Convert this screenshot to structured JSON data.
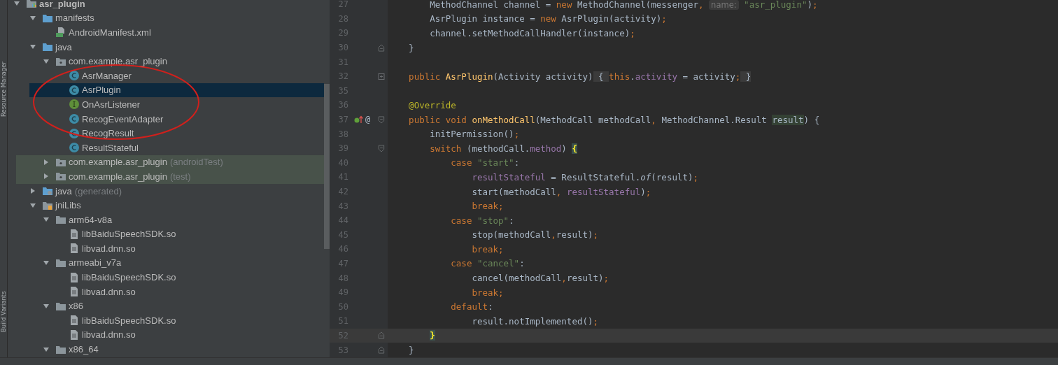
{
  "side_tabs": [
    {
      "label": "Resource Manager"
    },
    {
      "label": "Build Variants"
    }
  ],
  "project_tree": [
    {
      "label": "asr_plugin",
      "kind": "module",
      "expanded": true,
      "selected": false,
      "children": [
        {
          "label": "manifests",
          "kind": "folder",
          "expanded": true,
          "selected": false,
          "children": [
            {
              "label": "AndroidManifest.xml",
              "kind": "manifest",
              "selected": false
            }
          ]
        },
        {
          "label": "java",
          "kind": "folder",
          "expanded": true,
          "selected": false,
          "children": [
            {
              "label": "com.example.asr_plugin",
              "kind": "package",
              "expanded": true,
              "selected": false,
              "children": [
                {
                  "label": "AsrManager",
                  "kind": "class",
                  "selected": false
                },
                {
                  "label": "AsrPlugin",
                  "kind": "class",
                  "selected": true
                },
                {
                  "label": "OnAsrListener",
                  "kind": "interface",
                  "selected": false
                },
                {
                  "label": "RecogEventAdapter",
                  "kind": "class",
                  "selected": false
                },
                {
                  "label": "RecogResult",
                  "kind": "class",
                  "selected": false
                },
                {
                  "label": "ResultStateful",
                  "kind": "class",
                  "selected": false
                }
              ]
            },
            {
              "label": "com.example.asr_plugin",
              "suffix": "(androidTest)",
              "kind": "test-package",
              "expanded": false,
              "selected": false
            },
            {
              "label": "com.example.asr_plugin",
              "suffix": "(test)",
              "kind": "test-package",
              "expanded": false,
              "selected": false
            }
          ]
        },
        {
          "label": "java",
          "suffix": "(generated)",
          "kind": "generated-folder",
          "expanded": false,
          "selected": false
        },
        {
          "label": "jniLibs",
          "kind": "libs-folder",
          "expanded": true,
          "selected": false,
          "children": [
            {
              "label": "arm64-v8a",
              "kind": "plain-folder",
              "expanded": true,
              "selected": false,
              "children": [
                {
                  "label": "libBaiduSpeechSDK.so",
                  "kind": "file",
                  "selected": false
                },
                {
                  "label": "libvad.dnn.so",
                  "kind": "file",
                  "selected": false
                }
              ]
            },
            {
              "label": "armeabi_v7a",
              "kind": "plain-folder",
              "expanded": true,
              "selected": false,
              "children": [
                {
                  "label": "libBaiduSpeechSDK.so",
                  "kind": "file",
                  "selected": false
                },
                {
                  "label": "libvad.dnn.so",
                  "kind": "file",
                  "selected": false
                }
              ]
            },
            {
              "label": "x86",
              "kind": "plain-folder",
              "expanded": true,
              "selected": false,
              "children": [
                {
                  "label": "libBaiduSpeechSDK.so",
                  "kind": "file",
                  "selected": false
                },
                {
                  "label": "libvad.dnn.so",
                  "kind": "file",
                  "selected": false
                }
              ]
            },
            {
              "label": "x86_64",
              "kind": "plain-folder",
              "expanded": true,
              "selected": false
            }
          ]
        }
      ]
    }
  ],
  "editor": {
    "lines": [
      {
        "number": "27",
        "current": false,
        "tokens": [
          {
            "kind": "plain",
            "text": "        MethodChannel channel = "
          },
          {
            "kind": "kw",
            "text": "new "
          },
          {
            "kind": "plain",
            "text": "MethodChannel(messenger"
          },
          {
            "kind": "kw",
            "text": ", "
          },
          {
            "kind": "hint",
            "text": "name:"
          },
          {
            "kind": "str",
            "text": " \"asr_plugin\""
          },
          {
            "kind": "plain",
            "text": ")"
          },
          {
            "kind": "kw",
            "text": ";"
          }
        ]
      },
      {
        "number": "28",
        "current": false,
        "tokens": [
          {
            "kind": "plain",
            "text": "        AsrPlugin instance = "
          },
          {
            "kind": "kw",
            "text": "new "
          },
          {
            "kind": "plain",
            "text": "AsrPlugin(activity)"
          },
          {
            "kind": "kw",
            "text": ";"
          }
        ]
      },
      {
        "number": "29",
        "current": false,
        "tokens": [
          {
            "kind": "plain",
            "text": "        channel.setMethodCallHandler(instance)"
          },
          {
            "kind": "kw",
            "text": ";"
          }
        ]
      },
      {
        "number": "30",
        "current": false,
        "fold": {
          "kind": "end"
        },
        "tokens": [
          {
            "kind": "plain",
            "text": "    }"
          }
        ]
      },
      {
        "number": "31",
        "current": false
      },
      {
        "number": "32",
        "current": false,
        "fold": {
          "kind": "collapsed"
        },
        "tokens": [
          {
            "kind": "kw",
            "text": "    public "
          },
          {
            "kind": "method",
            "text": "AsrPlugin"
          },
          {
            "kind": "plain",
            "text": "(Activity activity)"
          },
          {
            "kind": "folded",
            "text": " { "
          },
          {
            "kind": "kw",
            "text": "this"
          },
          {
            "kind": "plain",
            "text": "."
          },
          {
            "kind": "field",
            "text": "activity"
          },
          {
            "kind": "plain",
            "text": " = activity"
          },
          {
            "kind": "kw",
            "text": ";"
          },
          {
            "kind": "folded",
            "text": " }"
          }
        ]
      },
      {
        "number": "35",
        "current": false
      },
      {
        "number": "36",
        "current": false,
        "tokens": [
          {
            "kind": "annotation",
            "text": "    @Override"
          }
        ]
      },
      {
        "number": "37",
        "current": false,
        "fold": {
          "kind": "start"
        },
        "gutter_mark": "@",
        "tokens": [
          {
            "kind": "kw",
            "text": "    public void "
          },
          {
            "kind": "method",
            "text": "onMethodCall"
          },
          {
            "kind": "plain",
            "text": "(MethodCall methodCall"
          },
          {
            "kind": "kw",
            "text": ", "
          },
          {
            "kind": "plain",
            "text": "MethodChannel.Result "
          },
          {
            "kind": "usage",
            "text": "result"
          },
          {
            "kind": "plain",
            "text": ") {"
          }
        ]
      },
      {
        "number": "38",
        "current": false,
        "tokens": [
          {
            "kind": "plain",
            "text": "        initPermission()"
          },
          {
            "kind": "kw",
            "text": ";"
          }
        ]
      },
      {
        "number": "39",
        "current": false,
        "fold": {
          "kind": "start"
        },
        "tokens": [
          {
            "kind": "kw",
            "text": "        switch "
          },
          {
            "kind": "plain",
            "text": "(methodCall."
          },
          {
            "kind": "field",
            "text": "method"
          },
          {
            "kind": "plain",
            "text": ") "
          },
          {
            "kind": "brace-match",
            "text": "{"
          }
        ]
      },
      {
        "number": "40",
        "current": false,
        "tokens": [
          {
            "kind": "kw",
            "text": "            case "
          },
          {
            "kind": "str",
            "text": "\"start\""
          },
          {
            "kind": "plain",
            "text": ":"
          }
        ]
      },
      {
        "number": "41",
        "current": false,
        "tokens": [
          {
            "kind": "field",
            "text": "                resultStateful"
          },
          {
            "kind": "plain",
            "text": " = ResultStateful."
          },
          {
            "kind": "italic",
            "text": "of"
          },
          {
            "kind": "plain",
            "text": "(result)"
          },
          {
            "kind": "kw",
            "text": ";"
          }
        ]
      },
      {
        "number": "42",
        "current": false,
        "tokens": [
          {
            "kind": "plain",
            "text": "                start(methodCall"
          },
          {
            "kind": "kw",
            "text": ", "
          },
          {
            "kind": "field",
            "text": "resultStateful"
          },
          {
            "kind": "plain",
            "text": ")"
          },
          {
            "kind": "kw",
            "text": ";"
          }
        ]
      },
      {
        "number": "43",
        "current": false,
        "tokens": [
          {
            "kind": "kw",
            "text": "                break;"
          }
        ]
      },
      {
        "number": "44",
        "current": false,
        "tokens": [
          {
            "kind": "kw",
            "text": "            case "
          },
          {
            "kind": "str",
            "text": "\"stop\""
          },
          {
            "kind": "plain",
            "text": ":"
          }
        ]
      },
      {
        "number": "45",
        "current": false,
        "tokens": [
          {
            "kind": "plain",
            "text": "                stop(methodCall"
          },
          {
            "kind": "kw",
            "text": ","
          },
          {
            "kind": "plain",
            "text": "result)"
          },
          {
            "kind": "kw",
            "text": ";"
          }
        ]
      },
      {
        "number": "46",
        "current": false,
        "tokens": [
          {
            "kind": "kw",
            "text": "                break;"
          }
        ]
      },
      {
        "number": "47",
        "current": false,
        "tokens": [
          {
            "kind": "kw",
            "text": "            case "
          },
          {
            "kind": "str",
            "text": "\"cancel\""
          },
          {
            "kind": "plain",
            "text": ":"
          }
        ]
      },
      {
        "number": "48",
        "current": false,
        "tokens": [
          {
            "kind": "plain",
            "text": "                cancel(methodCall"
          },
          {
            "kind": "kw",
            "text": ","
          },
          {
            "kind": "plain",
            "text": "result)"
          },
          {
            "kind": "kw",
            "text": ";"
          }
        ]
      },
      {
        "number": "49",
        "current": false,
        "tokens": [
          {
            "kind": "kw",
            "text": "                break;"
          }
        ]
      },
      {
        "number": "50",
        "current": false,
        "tokens": [
          {
            "kind": "kw",
            "text": "            default"
          },
          {
            "kind": "plain",
            "text": ":"
          }
        ]
      },
      {
        "number": "51",
        "current": false,
        "tokens": [
          {
            "kind": "plain",
            "text": "                result.notImplemented()"
          },
          {
            "kind": "kw",
            "text": ";"
          }
        ]
      },
      {
        "number": "52",
        "current": true,
        "fold": {
          "kind": "end"
        },
        "tokens": [
          {
            "kind": "brace-match",
            "text": "        }"
          }
        ]
      },
      {
        "number": "53",
        "current": false,
        "fold": {
          "kind": "end"
        },
        "tokens": [
          {
            "kind": "plain",
            "text": "    }"
          }
        ]
      }
    ]
  }
}
